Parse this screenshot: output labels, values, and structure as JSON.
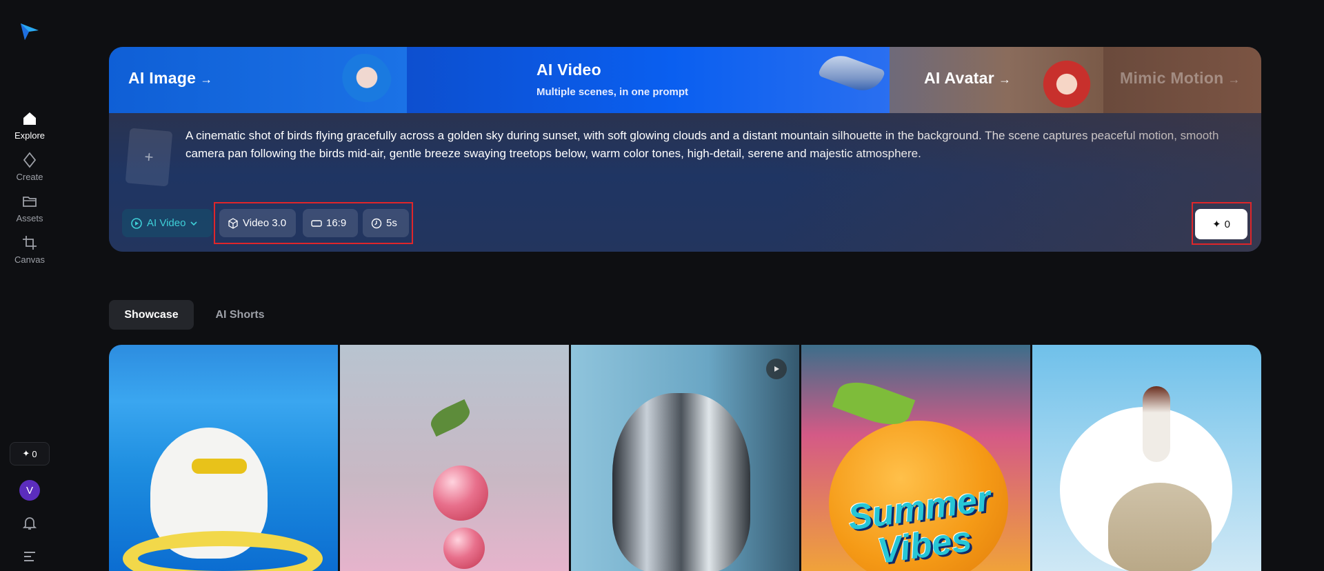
{
  "sidebar": {
    "items": [
      {
        "label": "Explore",
        "icon": "home-icon",
        "active": true
      },
      {
        "label": "Create",
        "icon": "diamond-icon",
        "active": false
      },
      {
        "label": "Assets",
        "icon": "folder-icon",
        "active": false
      },
      {
        "label": "Canvas",
        "icon": "crop-icon",
        "active": false
      }
    ],
    "credits": "0",
    "avatar_initial": "V"
  },
  "hero": {
    "tabs": [
      {
        "label": "AI Image",
        "arrow": "→"
      },
      {
        "label": "AI Video",
        "subtitle": "Multiple scenes, in one prompt"
      },
      {
        "label": "AI Avatar",
        "arrow": "→"
      },
      {
        "label": "Mimic Motion",
        "arrow": "→"
      }
    ],
    "prompt": "A cinematic shot of birds flying gracefully across a golden sky during sunset, with soft glowing clouds and a distant mountain silhouette in the background. The scene captures peaceful motion, smooth camera pan following the birds mid-air, gentle breeze swaying treetops below, warm color tones, high-detail, serene and majestic atmosphere.",
    "upload_symbol": "+",
    "controls": {
      "mode": "AI Video",
      "model": "Video 3.0",
      "ratio": "16:9",
      "duration": "5s"
    },
    "generate_cost": "0"
  },
  "showcase": {
    "tabs": [
      "Showcase",
      "AI Shorts"
    ],
    "cards": [
      {
        "name": "cat-pool-card"
      },
      {
        "name": "cherry-card"
      },
      {
        "name": "metal-tulip-card"
      },
      {
        "name": "summer-vibes-card",
        "text": "Summer Vibes"
      },
      {
        "name": "cloud-cat-card"
      }
    ]
  },
  "colors": {
    "accent_teal": "#3fd0d8",
    "highlight_red": "#e0262a",
    "bg": "#0e0f12"
  }
}
